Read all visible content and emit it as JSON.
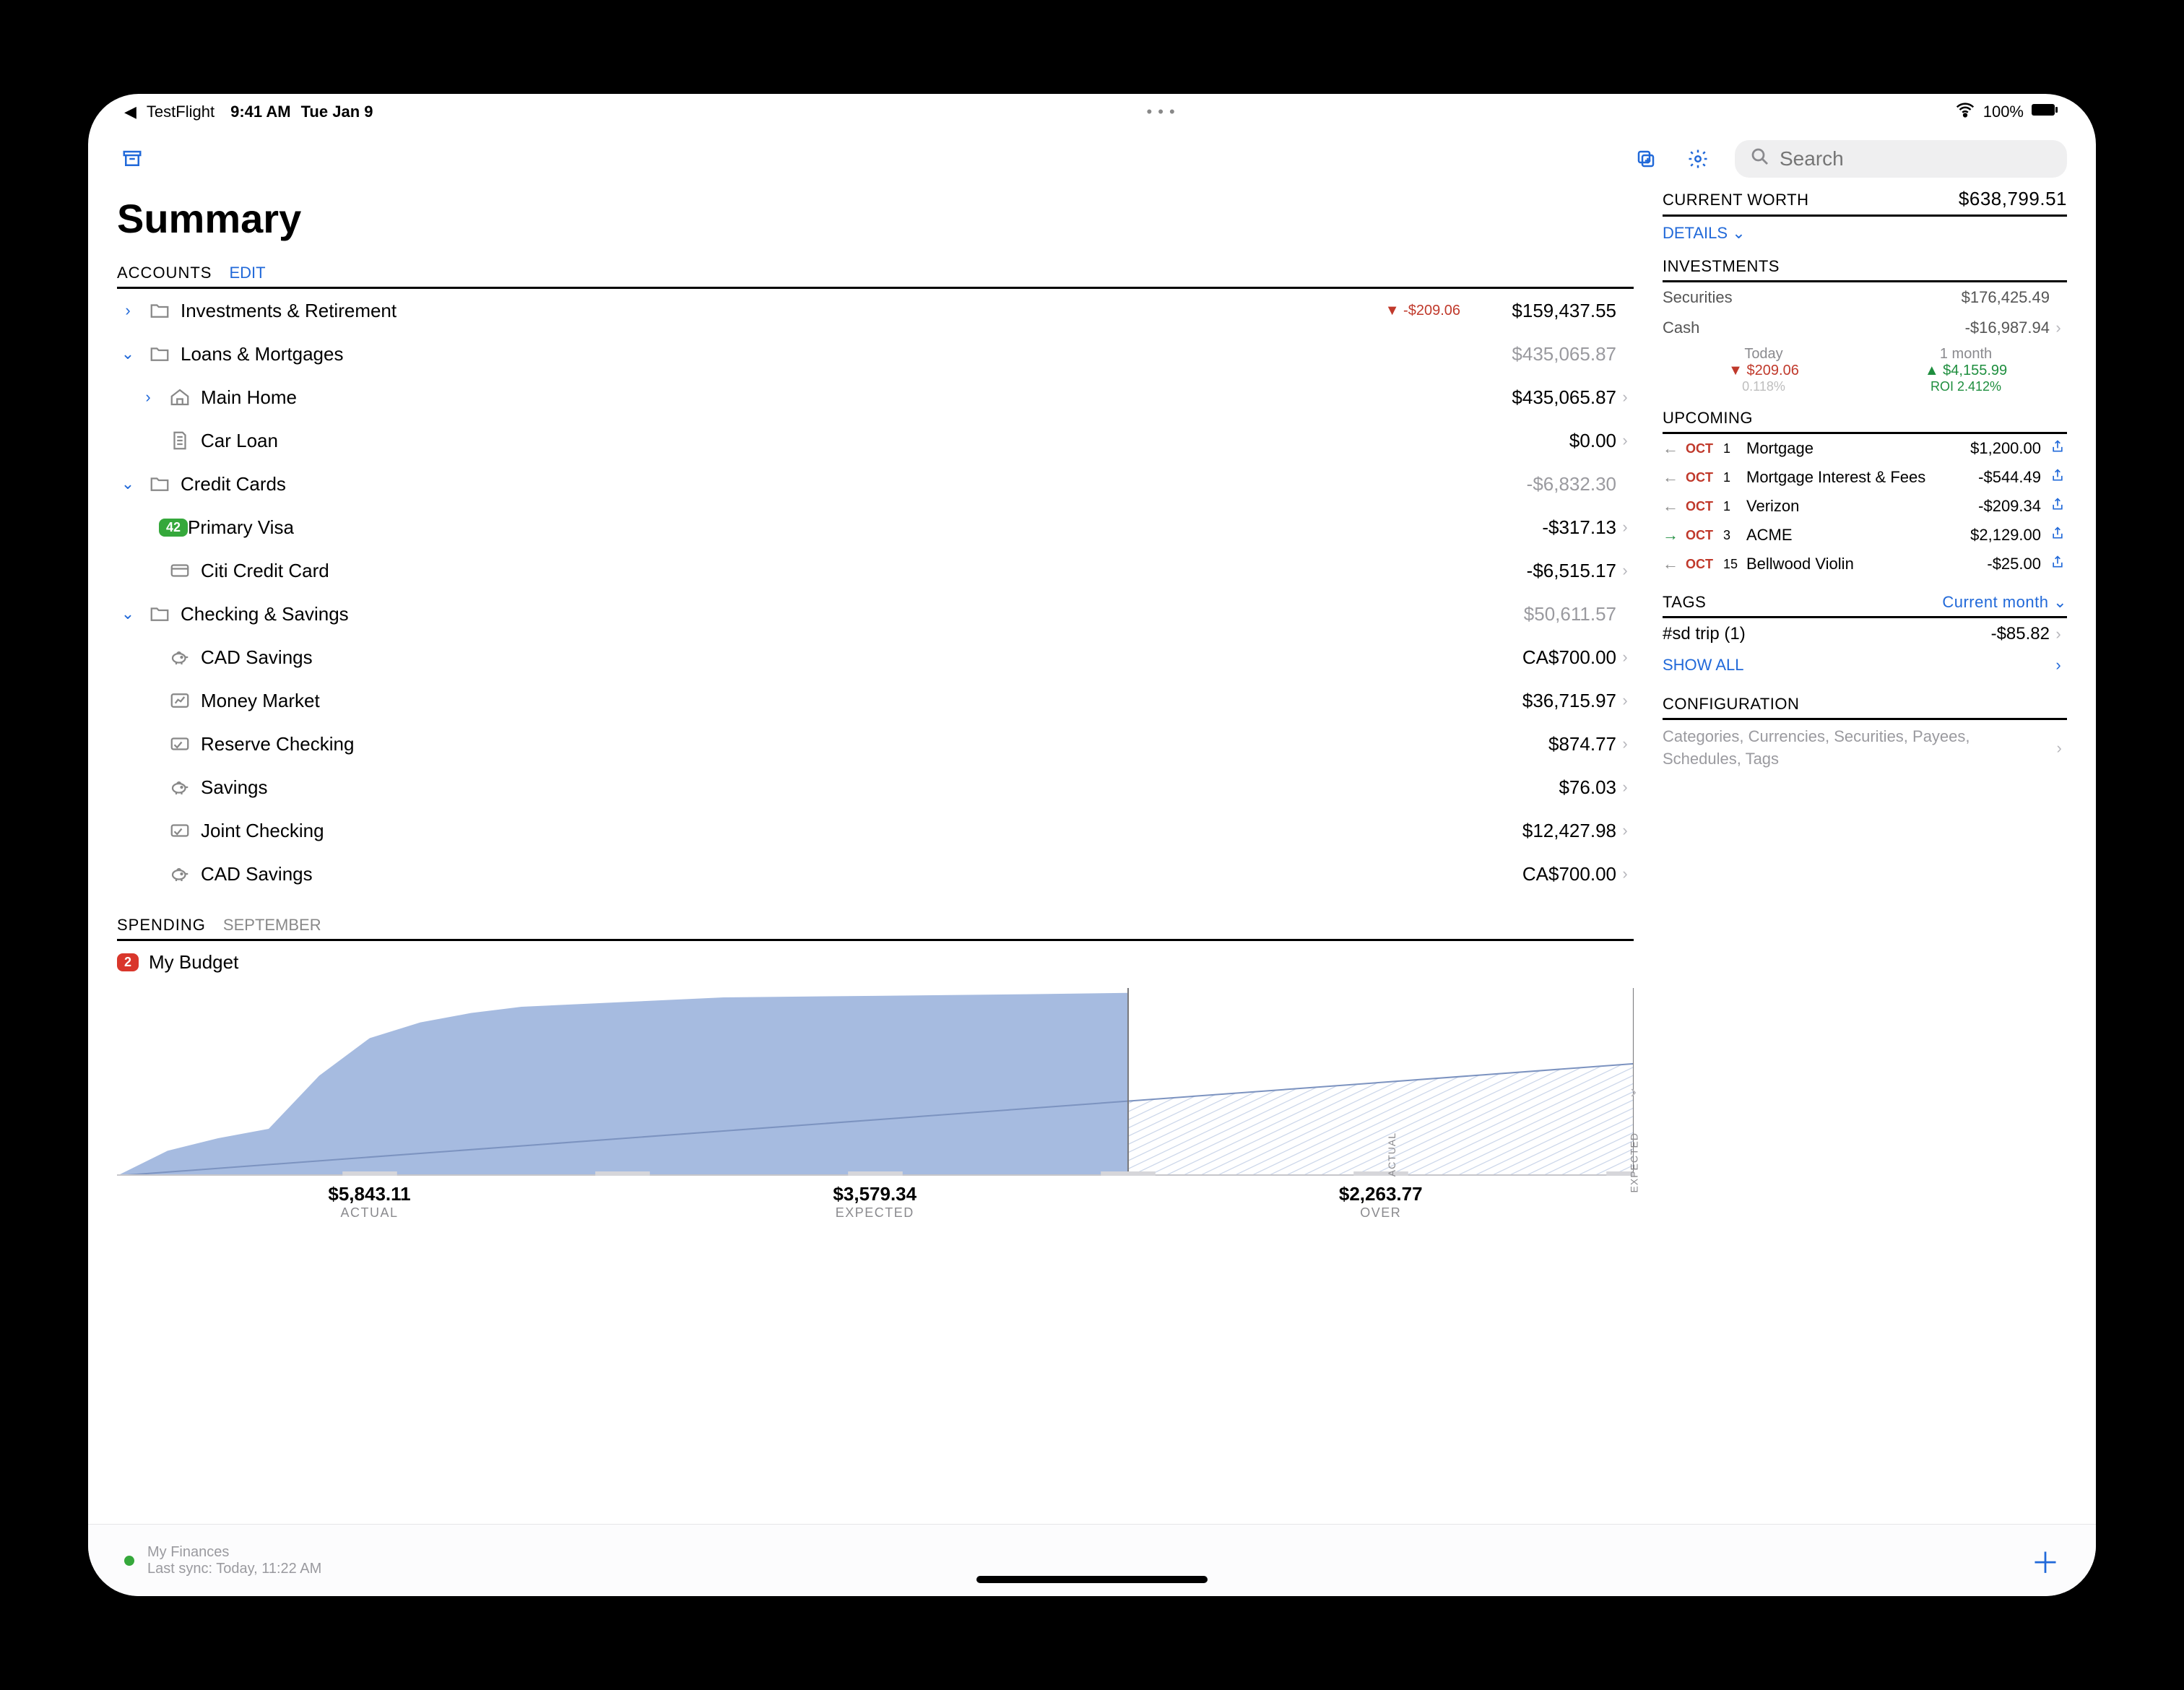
{
  "status_bar": {
    "back_app": "TestFlight",
    "time": "9:41 AM",
    "date": "Tue Jan 9",
    "battery": "100%"
  },
  "search_placeholder": "Search",
  "page_title": "Summary",
  "accounts": {
    "header": "ACCOUNTS",
    "edit": "EDIT",
    "rows": [
      {
        "indent": 0,
        "arrow": "right",
        "icon": "folder",
        "name": "Investments & Retirement",
        "delta": "▼ -$209.06",
        "amount": "$159,437.55",
        "gray": false,
        "chev": false
      },
      {
        "indent": 0,
        "arrow": "down",
        "icon": "folder",
        "name": "Loans & Mortgages",
        "amount": "$435,065.87",
        "gray": true,
        "chev": false
      },
      {
        "indent": 1,
        "arrow": "right",
        "icon": "home",
        "name": "Main Home",
        "amount": "$435,065.87",
        "gray": false,
        "chev": true
      },
      {
        "indent": 1,
        "arrow": "",
        "icon": "doc",
        "name": "Car Loan",
        "amount": "$0.00",
        "gray": false,
        "chev": true
      },
      {
        "indent": 0,
        "arrow": "down",
        "icon": "folder",
        "name": "Credit Cards",
        "amount": "-$6,832.30",
        "gray": true,
        "chev": false
      },
      {
        "indent": 1,
        "arrow": "",
        "icon": "badge",
        "badge": "42",
        "name": "Primary Visa",
        "amount": "-$317.13",
        "gray": false,
        "chev": true
      },
      {
        "indent": 1,
        "arrow": "",
        "icon": "card",
        "name": "Citi Credit Card",
        "amount": "-$6,515.17",
        "gray": false,
        "chev": true
      },
      {
        "indent": 0,
        "arrow": "down",
        "icon": "folder",
        "name": "Checking & Savings",
        "amount": "$50,611.57",
        "gray": true,
        "chev": false
      },
      {
        "indent": 1,
        "arrow": "",
        "icon": "piggy",
        "name": "CAD Savings",
        "amount": "CA$700.00",
        "gray": false,
        "chev": true
      },
      {
        "indent": 1,
        "arrow": "",
        "icon": "chart",
        "name": "Money Market",
        "amount": "$36,715.97",
        "gray": false,
        "chev": true
      },
      {
        "indent": 1,
        "arrow": "",
        "icon": "check",
        "name": "Reserve Checking",
        "amount": "$874.77",
        "gray": false,
        "chev": true
      },
      {
        "indent": 1,
        "arrow": "",
        "icon": "piggy",
        "name": "Savings",
        "amount": "$76.03",
        "gray": false,
        "chev": true
      },
      {
        "indent": 1,
        "arrow": "",
        "icon": "check",
        "name": "Joint Checking",
        "amount": "$12,427.98",
        "gray": false,
        "chev": true
      },
      {
        "indent": 1,
        "arrow": "",
        "icon": "piggy",
        "name": "CAD Savings",
        "amount": "CA$700.00",
        "gray": false,
        "chev": true
      }
    ]
  },
  "spending": {
    "header": "SPENDING",
    "month": "SEPTEMBER",
    "budget_badge": "2",
    "budget_name": "My Budget",
    "labels": [
      {
        "value": "$5,843.11",
        "caption": "ACTUAL"
      },
      {
        "value": "$3,579.34",
        "caption": "EXPECTED"
      },
      {
        "value": "$2,263.77",
        "caption": "OVER"
      }
    ],
    "axis_actual": "ACTUAL",
    "axis_expected": "EXPECTED"
  },
  "current_worth": {
    "label": "CURRENT WORTH",
    "value": "$638,799.51",
    "details": "DETAILS"
  },
  "investments": {
    "label": "INVESTMENTS",
    "rows": [
      {
        "name": "Securities",
        "amount": "$176,425.49"
      },
      {
        "name": "Cash",
        "amount": "-$16,987.94"
      }
    ],
    "perf": [
      {
        "period": "Today",
        "change": "▼ $209.06",
        "sub": "0.118%",
        "color": "red"
      },
      {
        "period": "1 month",
        "change": "▲ $4,155.99",
        "sub": "ROI 2.412%",
        "color": "green"
      }
    ]
  },
  "upcoming": {
    "label": "UPCOMING",
    "items": [
      {
        "dir": "left",
        "mon": "OCT",
        "day": "1",
        "name": "Mortgage",
        "amount": "$1,200.00"
      },
      {
        "dir": "left",
        "mon": "OCT",
        "day": "1",
        "name": "Mortgage Interest & Fees",
        "amount": "-$544.49"
      },
      {
        "dir": "left",
        "mon": "OCT",
        "day": "1",
        "name": "Verizon",
        "amount": "-$209.34"
      },
      {
        "dir": "right",
        "mon": "OCT",
        "day": "3",
        "name": "ACME",
        "amount": "$2,129.00"
      },
      {
        "dir": "left",
        "mon": "OCT",
        "day": "15",
        "name": "Bellwood Violin",
        "amount": "-$25.00"
      }
    ]
  },
  "tags": {
    "label": "TAGS",
    "filter": "Current month",
    "rows": [
      {
        "name": "#sd trip (1)",
        "amount": "-$85.82"
      }
    ],
    "show_all": "SHOW ALL"
  },
  "configuration": {
    "label": "CONFIGURATION",
    "text": "Categories, Currencies, Securities, Payees, Schedules, Tags"
  },
  "footer": {
    "doc": "My Finances",
    "sync": "Last sync: Today, 11:22 AM"
  },
  "chart_data": {
    "type": "area",
    "title": "September spending — actual vs expected",
    "series": [
      {
        "name": "Actual",
        "x": [
          0,
          1,
          2,
          3,
          4,
          5,
          6,
          7,
          8,
          10,
          12,
          15,
          18,
          20
        ],
        "y": [
          0,
          800,
          1200,
          1500,
          3200,
          4400,
          4900,
          5200,
          5400,
          5550,
          5700,
          5750,
          5800,
          5843
        ]
      },
      {
        "name": "Expected",
        "x": [
          0,
          30
        ],
        "y": [
          0,
          3579
        ]
      }
    ],
    "xlim": [
      0,
      30
    ],
    "ylim": [
      0,
      6000
    ],
    "vline_actual_day": 20
  }
}
